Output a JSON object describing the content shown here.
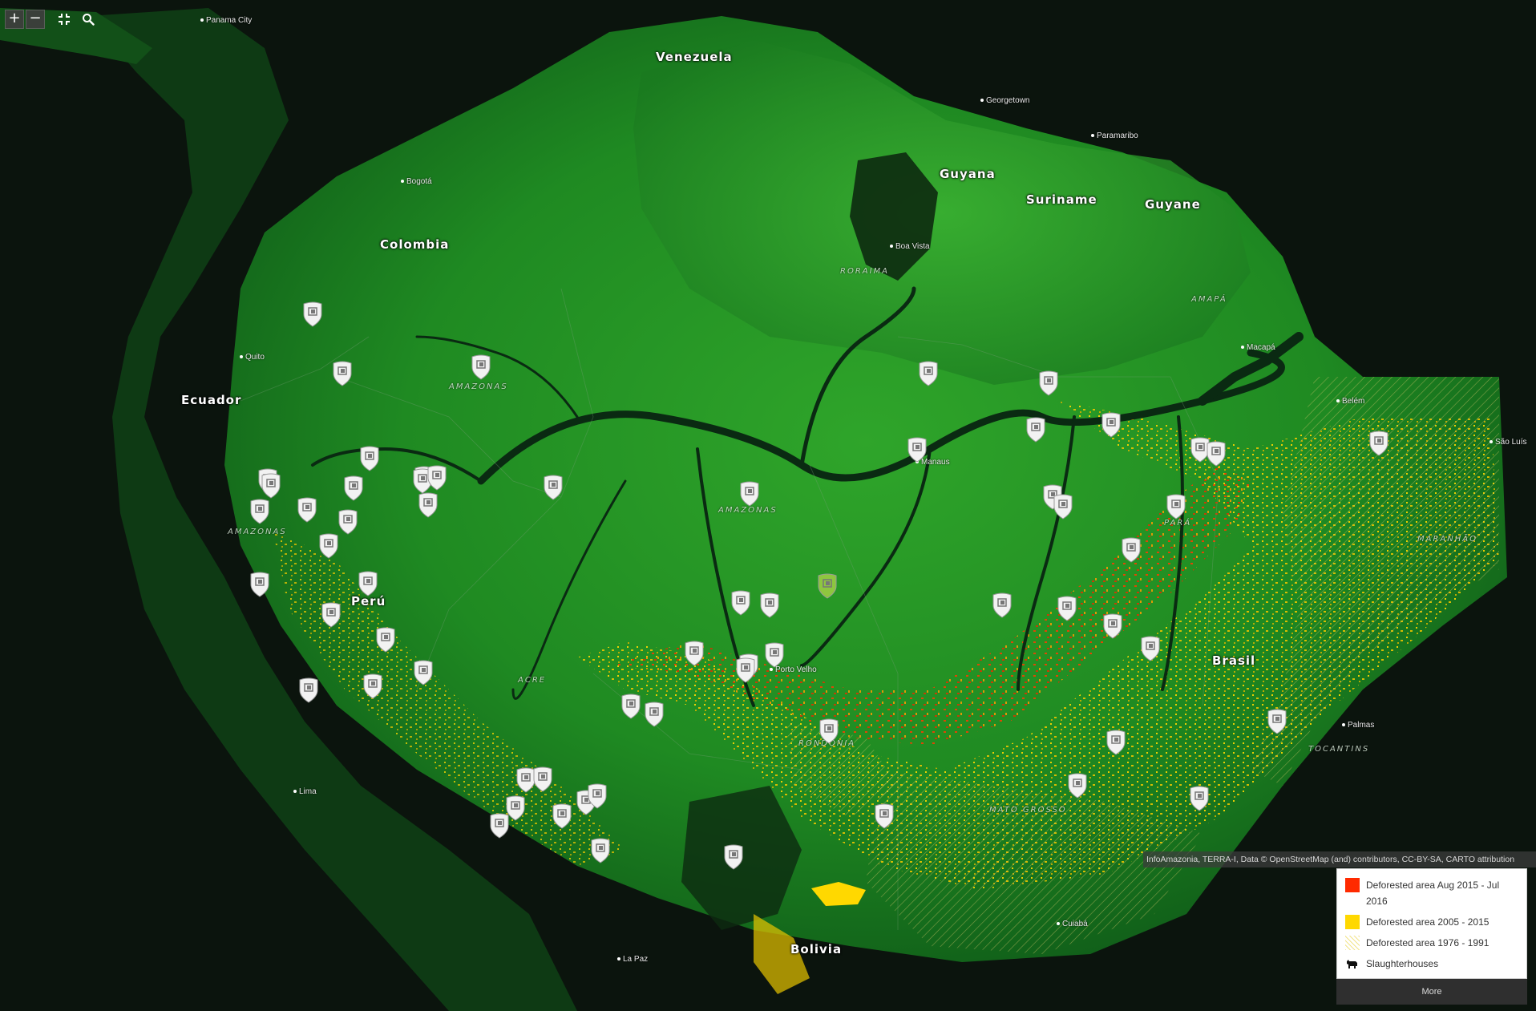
{
  "controls": {
    "zoom_in": "+",
    "zoom_out": "−"
  },
  "countries": {
    "venezuela": "Venezuela",
    "guyana": "Guyana",
    "suriname": "Suriname",
    "guyane": "Guyane",
    "colombia": "Colombia",
    "ecuador": "Ecuador",
    "peru": "Perú",
    "brasil": "Brasil",
    "bolivia": "Bolivia"
  },
  "regions": {
    "roraima": "RORAIMA",
    "amapa": "AMAPÁ",
    "amazonas_co": "AMAZONAS",
    "amazonas_br": "AMAZONAS",
    "amazonas_pe": "AMAZONAS",
    "para": "PARÁ",
    "maranhao": "MARANHÃO",
    "acre": "ACRE",
    "rondonia": "RONDÔNIA",
    "tocantins": "TOCANTINS",
    "mato_grosso": "MATO GROSSO"
  },
  "cities": {
    "panama": "Panama City",
    "georgetown": "Georgetown",
    "paramaribo": "Paramaribo",
    "bogota": "Bogotá",
    "boa_vista": "Boa Vista",
    "macapa": "Macapá",
    "quito": "Quito",
    "belem": "Belém",
    "sao_luis": "São Luís",
    "manaus": "Manaus",
    "porto_velho": "Porto Velho",
    "palmas": "Palmas",
    "lima": "Lima",
    "cuiaba": "Cuiabá",
    "la_paz": "La Paz"
  },
  "colors": {
    "recent_deforestation": "#ff2a00",
    "deforestation_2005_2015": "#ffd800",
    "deforestation_1976_1991": "#f2e48a",
    "forest": "#2fa52a",
    "background": "#0b140d"
  },
  "attribution": "InfoAmazonia, TERRA-I, Data © OpenStreetMap (and) contributors, CC-BY-SA, CARTO attribution",
  "legend": {
    "items": [
      {
        "label": "Deforested area Aug 2015 - Jul 2016",
        "color": "#ff2a00",
        "icon": "red-square"
      },
      {
        "label": "Deforested area 2005 - 2015",
        "color": "#ffd800",
        "icon": "yellow-square"
      },
      {
        "label": "Deforested area 1976 - 1991",
        "color": "#f2e48a",
        "icon": "hatched-square"
      },
      {
        "label": "Slaughterhouses",
        "color": "#000000",
        "icon": "cow-icon"
      }
    ],
    "more_label": "More"
  }
}
